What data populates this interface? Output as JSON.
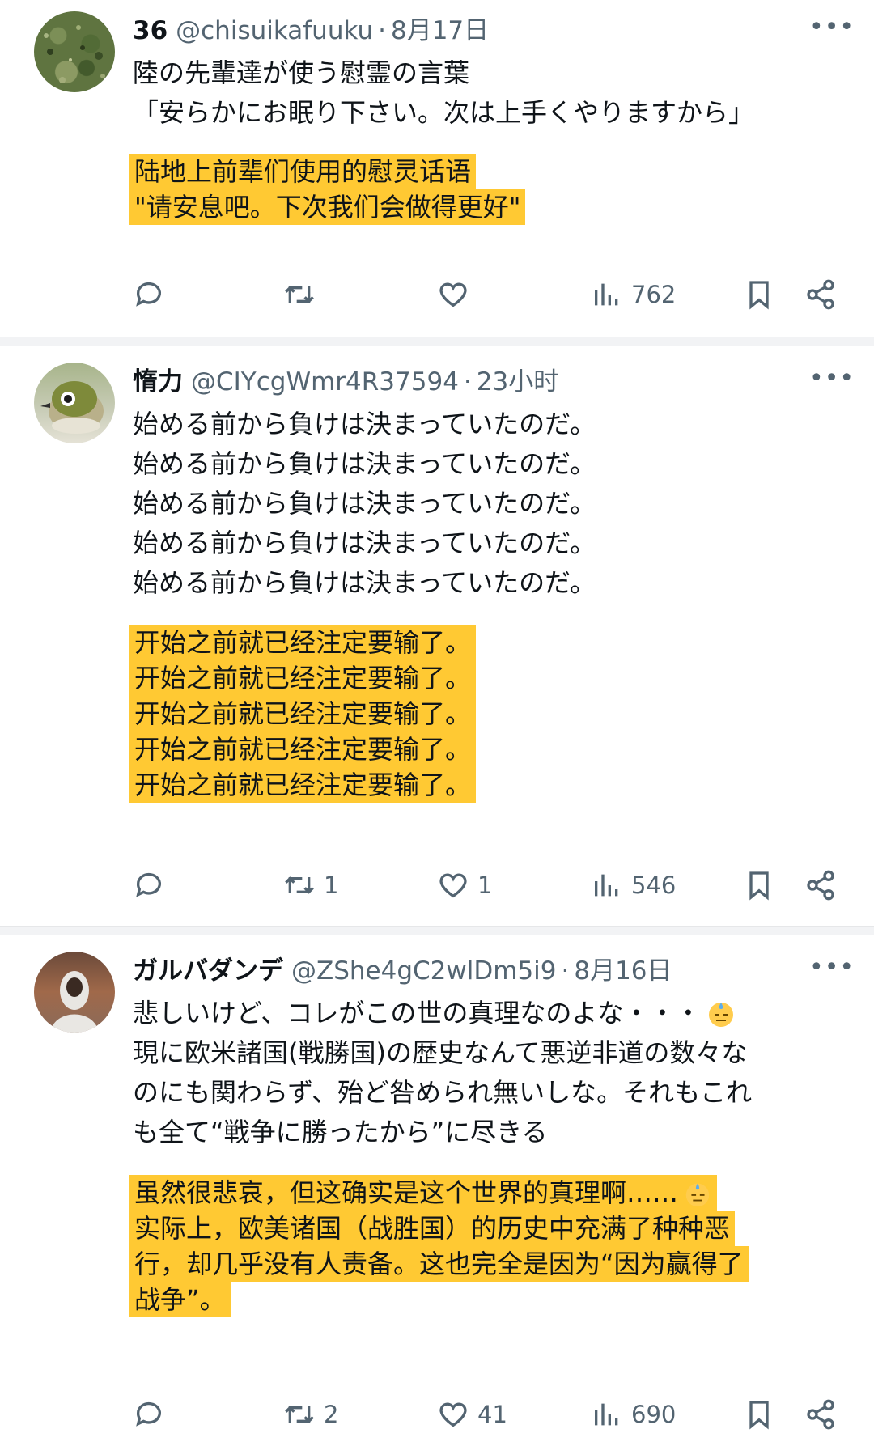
{
  "tweets": [
    {
      "name": "36",
      "handle": "@chisuikafuuku",
      "time": "8月17日",
      "text": [
        "陸の先輩達が使う慰霊の言葉",
        "「安らかにお眠り下さい。次は上手くやりますから」"
      ],
      "translation": [
        "陆地上前辈们使用的慰灵话语",
        "\"请安息吧。下次我们会做得更好\""
      ],
      "stats": {
        "reply": "",
        "retweet": "",
        "like": "",
        "views": "762"
      }
    },
    {
      "name": "惰力",
      "handle": "@CIYcgWmr4R37594",
      "time": "23小时",
      "text": [
        "始める前から負けは決まっていたのだ。",
        "始める前から負けは決まっていたのだ。",
        "始める前から負けは決まっていたのだ。",
        "始める前から負けは決まっていたのだ。",
        "始める前から負けは決まっていたのだ。"
      ],
      "translation": [
        "开始之前就已经注定要输了。",
        "开始之前就已经注定要输了。",
        "开始之前就已经注定要输了。",
        "开始之前就已经注定要输了。",
        "开始之前就已经注定要输了。"
      ],
      "stats": {
        "reply": "",
        "retweet": "1",
        "like": "1",
        "views": "546"
      }
    },
    {
      "name": "ガルバダンデ",
      "handle": "@ZShe4gC2wlDm5i9",
      "time": "8月16日",
      "text": [
        "悲しいけど、コレがこの世の真理なのよな・・・",
        "現に欧米諸国(戦勝国)の歴史なんて悪逆非道の数々な",
        "のにも関わらず、殆ど咎められ無いしな。それもこれ",
        "も全て“戦争に勝ったから”に尽きる"
      ],
      "translation": [
        "虽然很悲哀，但这确实是这个世界的真理啊……",
        "实际上，欧美诸国（战胜国）的历史中充满了种种恶",
        "行，却几乎没有人责备。这也完全是因为“因为赢得了",
        "战争”。"
      ],
      "stats": {
        "reply": "",
        "retweet": "2",
        "like": "41",
        "views": "690"
      }
    }
  ],
  "icons": {
    "reply": "reply-icon",
    "retweet": "retweet-icon",
    "like": "like-icon",
    "views": "views-icon",
    "bookmark": "bookmark-icon",
    "share": "share-icon",
    "more": "more-icon"
  },
  "colors": {
    "highlight": "#ffc933",
    "meta": "#536471",
    "text": "#0f1419"
  }
}
